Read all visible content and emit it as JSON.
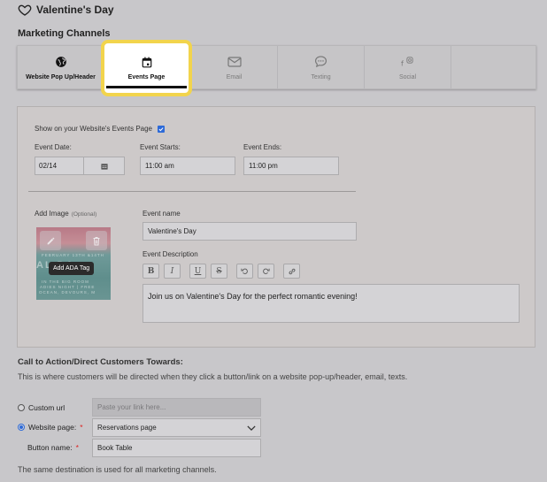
{
  "page": {
    "title": "Valentine's Day",
    "section_label": "Marketing Channels"
  },
  "tabs": [
    {
      "label": "Website Pop Up/Header",
      "icon": "globe-icon"
    },
    {
      "label": "Events Page",
      "icon": "calendar-icon",
      "active": true
    },
    {
      "label": "Email",
      "icon": "mail-icon"
    },
    {
      "label": "Texting",
      "icon": "chat-icon"
    },
    {
      "label": "Social",
      "icon": "social-icon"
    }
  ],
  "events_panel": {
    "show_label": "Show on your Website's Events Page",
    "show_checked": true,
    "event_date_label": "Event Date:",
    "event_date_value": "02/14",
    "event_starts_label": "Event Starts:",
    "event_starts_value": "11:00 am",
    "event_ends_label": "Event Ends:",
    "event_ends_value": "11:00 pm",
    "add_image_label": "Add Image",
    "add_image_optional": "(Optional)",
    "ada_tag_label": "Add ADA Tag",
    "thumb_line1": "FEBRUARY 13TH &14TH",
    "thumb_line2": "AL         DA",
    "thumb_line3": "IN THE BIG ROOM",
    "thumb_line4": "ADIES NIGHT | FREE",
    "thumb_line5": "OCEAN, DEVOURS, M",
    "event_name_label": "Event name",
    "event_name_value": "Valentine's Day",
    "event_desc_label": "Event Description",
    "event_desc_value": "Join us on Valentine's Day for the perfect romantic evening!",
    "toolbar": {
      "bold": "B",
      "italic": "I",
      "underline": "U",
      "strike": "S"
    }
  },
  "cta": {
    "title": "Call to Action/Direct Customers Towards:",
    "description": "This is where customers will be directed when they click a button/link on a website pop-up/header, email, texts.",
    "custom_url_label": "Custom url",
    "custom_url_placeholder": "Paste your link here...",
    "website_page_label": "Website page:",
    "website_page_value": "Reservations page",
    "button_name_label": "Button name:",
    "button_name_value": "Book Table",
    "required_mark": "*",
    "footer_note": "The same destination is used for all marketing channels."
  },
  "colors": {
    "background": "#c8c7ca",
    "accent_yellow": "#f2d44c",
    "checkbox_blue": "#2d6ad8",
    "required_red": "#dd2222"
  }
}
